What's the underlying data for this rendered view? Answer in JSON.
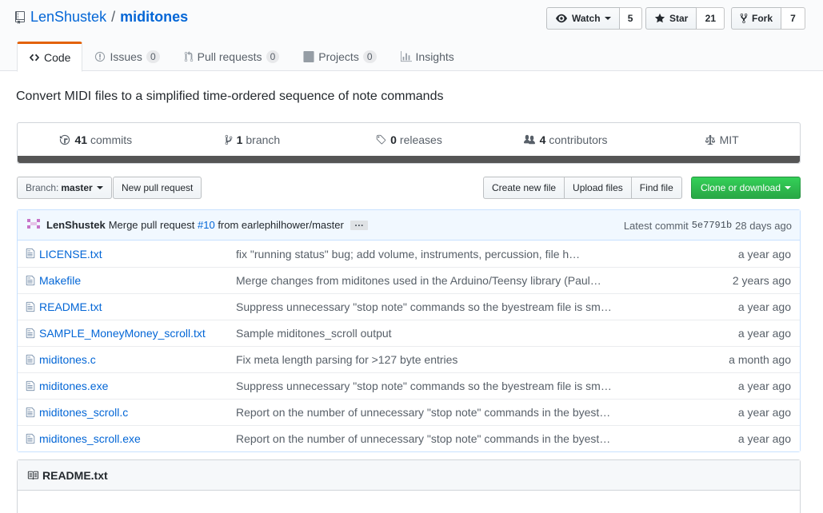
{
  "repo": {
    "owner": "LenShustek",
    "separator": "/",
    "name": "miditones",
    "description": "Convert MIDI files to a simplified time-ordered sequence of note commands"
  },
  "actions": {
    "watch": {
      "label": "Watch",
      "count": "5"
    },
    "star": {
      "label": "Star",
      "count": "21"
    },
    "fork": {
      "label": "Fork",
      "count": "7"
    }
  },
  "tabs": [
    {
      "label": "Code",
      "icon": "code-icon",
      "selected": true
    },
    {
      "label": "Issues",
      "icon": "issue-icon",
      "count": "0"
    },
    {
      "label": "Pull requests",
      "icon": "pull-request-icon",
      "count": "0"
    },
    {
      "label": "Projects",
      "icon": "project-icon",
      "count": "0"
    },
    {
      "label": "Insights",
      "icon": "graph-icon"
    }
  ],
  "summary": {
    "commits": {
      "num": "41",
      "label": "commits"
    },
    "branches": {
      "num": "1",
      "label": "branch"
    },
    "releases": {
      "num": "0",
      "label": "releases"
    },
    "contributors": {
      "num": "4",
      "label": "contributors"
    },
    "license": "MIT",
    "language_bar_color": "#555555"
  },
  "filenav": {
    "branch_label": "Branch:",
    "branch_value": "master",
    "new_pr": "New pull request",
    "create_file": "Create new file",
    "upload_files": "Upload files",
    "find_file": "Find file",
    "clone": "Clone or download"
  },
  "latest_commit": {
    "author": "LenShustek",
    "message_prefix": "Merge pull request",
    "issue": "#10",
    "message_suffix": "from earlephilhower/master",
    "ellipsis": "…",
    "latest_label": "Latest commit",
    "sha": "5e7791b",
    "age": "28 days ago"
  },
  "files": [
    {
      "name": "LICENSE.txt",
      "message": "fix \"running status\" bug; add volume, instruments, percussion, file h…",
      "age": "a year ago"
    },
    {
      "name": "Makefile",
      "message": "Merge changes from miditones used in the Arduino/Teensy library (Paul…",
      "age": "2 years ago"
    },
    {
      "name": "README.txt",
      "message": "Suppress unnecessary \"stop note\" commands so the byestream file is sm…",
      "age": "a year ago"
    },
    {
      "name": "SAMPLE_MoneyMoney_scroll.txt",
      "message": "Sample miditones_scroll output",
      "age": "a year ago"
    },
    {
      "name": "miditones.c",
      "message": "Fix meta length parsing for >127 byte entries",
      "age": "a month ago"
    },
    {
      "name": "miditones.exe",
      "message": "Suppress unnecessary \"stop note\" commands so the byestream file is sm…",
      "age": "a year ago"
    },
    {
      "name": "miditones_scroll.c",
      "message": "Report on the number of unnecessary \"stop note\" commands in the byest…",
      "age": "a year ago"
    },
    {
      "name": "miditones_scroll.exe",
      "message": "Report on the number of unnecessary \"stop note\" commands in the byest…",
      "age": "a year ago"
    }
  ],
  "readme": {
    "title": "README.txt"
  },
  "colors": {
    "accent": "#0366d6",
    "tab_active": "#e36209",
    "clone_green": "#28a745",
    "commit_bg": "#f1f8ff"
  }
}
